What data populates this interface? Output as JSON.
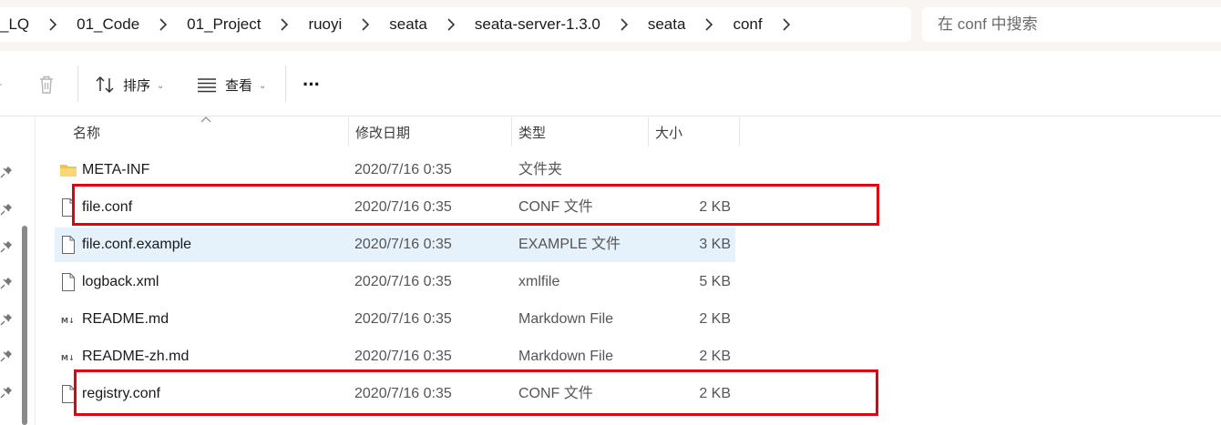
{
  "breadcrumb": [
    "_LQ",
    "01_Code",
    "01_Project",
    "ruoyi",
    "seata",
    "seata-server-1.3.0",
    "seata",
    "conf"
  ],
  "search": {
    "placeholder": "在 conf 中搜索"
  },
  "toolbar": {
    "sort_label": "排序",
    "view_label": "查看",
    "more_label": "···"
  },
  "columns": {
    "name": "名称",
    "date": "修改日期",
    "type": "类型",
    "size": "大小"
  },
  "files": [
    {
      "name": "META-INF",
      "date": "2020/7/16 0:35",
      "type": "文件夹",
      "size": "",
      "icon": "folder-icon"
    },
    {
      "name": "file.conf",
      "date": "2020/7/16 0:35",
      "type": "CONF 文件",
      "size": "2 KB",
      "icon": "file-icon"
    },
    {
      "name": "file.conf.example",
      "date": "2020/7/16 0:35",
      "type": "EXAMPLE 文件",
      "size": "3 KB",
      "icon": "file-icon"
    },
    {
      "name": "logback.xml",
      "date": "2020/7/16 0:35",
      "type": "xmlfile",
      "size": "5 KB",
      "icon": "file-icon"
    },
    {
      "name": "README.md",
      "date": "2020/7/16 0:35",
      "type": "Markdown File",
      "size": "2 KB",
      "icon": "markdown-file-icon"
    },
    {
      "name": "README-zh.md",
      "date": "2020/7/16 0:35",
      "type": "Markdown File",
      "size": "2 KB",
      "icon": "markdown-file-icon"
    },
    {
      "name": "registry.conf",
      "date": "2020/7/16 0:35",
      "type": "CONF 文件",
      "size": "2 KB",
      "icon": "file-icon"
    }
  ],
  "colors": {
    "highlight_border": "#e3000f",
    "selected_row": "#e5f1fb",
    "folder": "#f2c14e"
  }
}
